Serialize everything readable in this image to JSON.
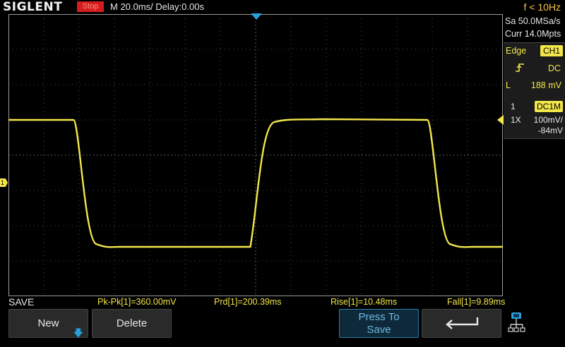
{
  "header": {
    "brand": "SIGLENT",
    "run_state": "Stop",
    "timebase": "M 20.0ms/ Delay:0.00s",
    "frequency": "f < 10Hz"
  },
  "acquisition": {
    "sample_rate": "Sa 50.0MSa/s",
    "memory_depth": "Curr 14.0Mpts"
  },
  "trigger": {
    "type_label": "Edge",
    "source": "CH1",
    "slope_icon": "rising-edge-icon",
    "coupling": "DC",
    "level_label": "L",
    "level": "188 mV"
  },
  "channel": {
    "number": "1",
    "coupling": "DC1M",
    "probe": "1X",
    "scale": "100mV/",
    "offset": "-84mV",
    "marker": "1"
  },
  "measurements": {
    "menu_title": "SAVE",
    "items": [
      {
        "label": "Pk-Pk[1]=360.00mV"
      },
      {
        "label": "Prd[1]=200.39ms"
      },
      {
        "label": "Rise[1]=10.48ms"
      },
      {
        "label": "Fall[1]=9.89ms"
      }
    ]
  },
  "softkeys": {
    "new": "New",
    "delete": "Delete",
    "save_line1": "Press To",
    "save_line2": "Save",
    "back_icon": "return-arrow-icon",
    "network_icon": "network-icon"
  },
  "colors": {
    "trace": "#f2e64a",
    "accent": "#2aa0d8",
    "stop": "#d51d1d",
    "freq": "#f5c542"
  },
  "waveform": {
    "type": "square",
    "high_level_mV": 176,
    "low_level_mV": -184,
    "period_ms": 200.39,
    "rise_ms": 10.48,
    "fall_ms": 9.89,
    "volts_per_div_mV": 100,
    "time_per_div_ms": 20
  }
}
